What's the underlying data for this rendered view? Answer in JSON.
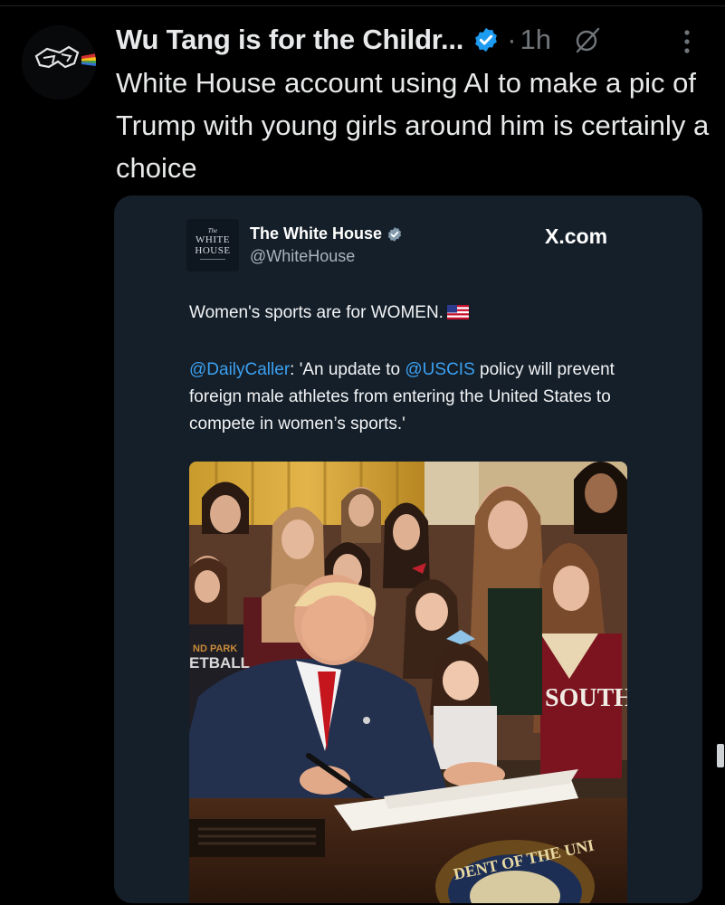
{
  "post": {
    "display_name": "Wu Tang is for the Childr...",
    "separator": "·",
    "time": "1h",
    "text": "White House account using AI to make a pic of Trump with young girls around him is certainly a choice"
  },
  "quoted": {
    "name": "The White House",
    "handle": "@WhiteHouse",
    "source": "X.com",
    "logo": {
      "the": "The",
      "line1": "WHITE",
      "line2": "HOUSE"
    },
    "text": "Women's sports are for WOMEN.",
    "quote_mention": "@DailyCaller",
    "quote_part1": ": 'An update to ",
    "quote_mention2": "@USCIS",
    "quote_part2": " policy will prevent foreign male athletes from entering the United States to compete in women’s sports.'"
  },
  "photo_text": {
    "jersey": "SOUTH",
    "shirt_line1": "ND PARK",
    "shirt_line2": "ETBALL",
    "seal": "DENT OF THE UNI"
  },
  "icons": {
    "avatar": "wu-tang-logo-icon",
    "verified": "verified-badge-icon",
    "grok": "grok-icon",
    "more": "more-options-icon",
    "flag": "us-flag-icon"
  },
  "colors": {
    "background": "#000000",
    "card": "#151f29",
    "verified_blue": "#1d9bf0",
    "mention": "#3ba0f0",
    "muted": "#71767b"
  }
}
